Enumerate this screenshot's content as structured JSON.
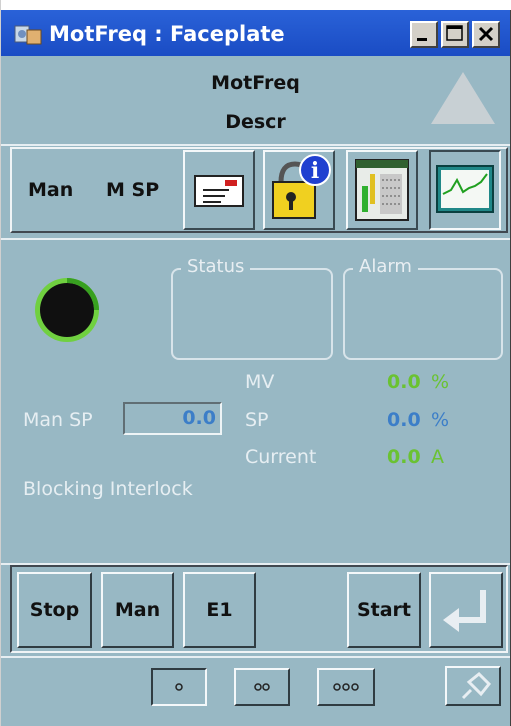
{
  "window": {
    "title": "MotFreq : Faceplate"
  },
  "header": {
    "tag": "MotFreq",
    "description": "Descr"
  },
  "toolbar": {
    "mode_label": "Man",
    "sp_label": "M SP"
  },
  "status": {
    "status_legend": "Status",
    "alarm_legend": "Alarm"
  },
  "values": {
    "mv_label": "MV",
    "mv_value": "0.0",
    "mv_unit": "%",
    "sp_label": "SP",
    "sp_value": "0.0",
    "sp_unit": "%",
    "current_label": "Current",
    "current_value": "0.0",
    "current_unit": "A",
    "man_sp_label": "Man SP",
    "man_sp_value": "0.0",
    "blocking_label": "Blocking Interlock"
  },
  "commands": {
    "stop": "Stop",
    "man": "Man",
    "e1": "E1",
    "start": "Start"
  },
  "colors": {
    "background": "#98b8c4",
    "green": "#6ac232",
    "blue": "#3c7ec8",
    "title": "#1a4cc4"
  },
  "icons": [
    "app-icon",
    "minimize-icon",
    "maximize-icon",
    "close-icon",
    "alarm-triangle-icon",
    "message-icon",
    "lock-info-icon",
    "faceplate-detail-icon",
    "trend-icon",
    "motor-status-icon",
    "enter-icon",
    "view-1-icon",
    "view-2-icon",
    "view-3-icon",
    "pin-icon"
  ]
}
